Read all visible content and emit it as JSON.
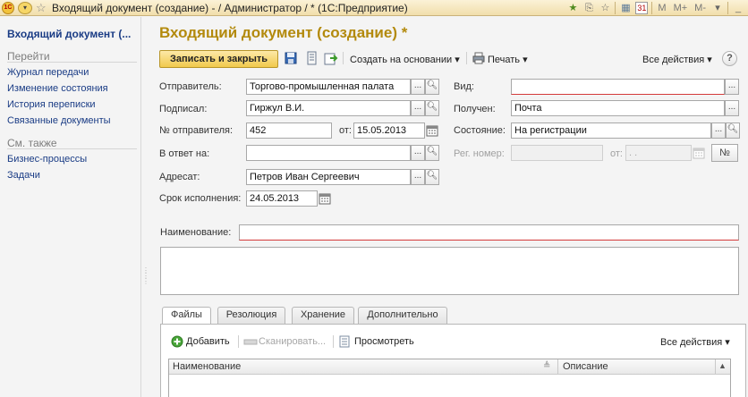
{
  "window": {
    "title": "Входящий документ (создание) - / Администратор / * (1С:Предприятие)",
    "logo_text": "1С",
    "calendar_day": "31",
    "memory_buttons": [
      "M",
      "M+",
      "M-"
    ]
  },
  "left_panel": {
    "current": "Входящий документ (...",
    "goto_title": "Перейти",
    "goto_items": [
      {
        "label": "Журнал передачи"
      },
      {
        "label": "Изменение состояния"
      },
      {
        "label": "История переписки"
      },
      {
        "label": "Связанные документы"
      }
    ],
    "see_also_title": "См. также",
    "see_also_items": [
      {
        "label": "Бизнес-процессы"
      },
      {
        "label": "Задачи"
      }
    ]
  },
  "form": {
    "title": "Входящий документ (создание) *",
    "toolbar": {
      "save_close": "Записать и закрыть",
      "create_based_on": "Создать на основании",
      "print": "Печать",
      "all_actions": "Все действия",
      "help": "?"
    },
    "fields": {
      "sender_label": "Отправитель:",
      "sender_value": "Торгово-промышленная палата",
      "signed_label": "Подписал:",
      "signed_value": "Гиржул В.И.",
      "sender_no_label": "№ отправителя:",
      "sender_no_value": "452",
      "from_label": "от:",
      "from_value": "15.05.2013",
      "reply_to_label": "В ответ на:",
      "reply_to_value": "",
      "addressee_label": "Адресат:",
      "addressee_value": "Петров Иван Сергеевич",
      "deadline_label": "Срок исполнения:",
      "deadline_value": "24.05.2013",
      "kind_label": "Вид:",
      "kind_value": "",
      "received_label": "Получен:",
      "received_value": "Почта",
      "state_label": "Состояние:",
      "state_value": "На регистрации",
      "reg_no_label": "Рег. номер:",
      "reg_no_value": "",
      "reg_from_label": "от:",
      "reg_from_value": " .  .",
      "number_button": "№",
      "name_label": "Наименование:",
      "name_value": ""
    },
    "tabs": [
      {
        "label": "Файлы",
        "active": true
      },
      {
        "label": "Резолюция",
        "active": false
      },
      {
        "label": "Хранение",
        "active": false
      },
      {
        "label": "Дополнительно",
        "active": false
      }
    ],
    "files_toolbar": {
      "add": "Добавить",
      "scan": "Сканировать...",
      "view": "Просмотреть",
      "all_actions": "Все действия"
    },
    "files_table": {
      "columns": [
        "Наименование",
        "Описание"
      ]
    }
  }
}
